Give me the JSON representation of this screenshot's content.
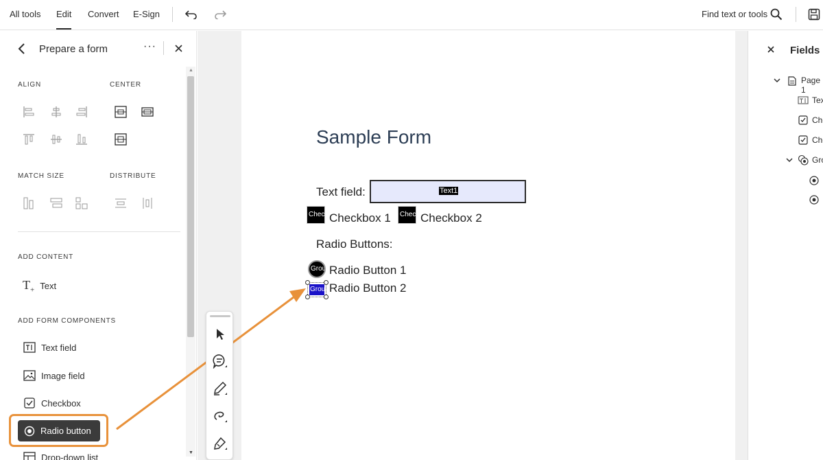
{
  "topbar": {
    "menu": [
      "All tools",
      "Edit",
      "Convert",
      "E-Sign"
    ],
    "search_label": "Find text or tools"
  },
  "left_panel": {
    "title": "Prepare a form",
    "align_label": "ALIGN",
    "center_label": "CENTER",
    "match_size_label": "MATCH SIZE",
    "distribute_label": "DISTRIBUTE",
    "add_content_label": "ADD CONTENT",
    "add_text": "Text",
    "add_form_label": "ADD FORM COMPONENTS",
    "components": [
      "Text field",
      "Image field",
      "Checkbox",
      "Radio button",
      "Drop-down list"
    ]
  },
  "document": {
    "title": "Sample Form",
    "text_field_label": "Text field:",
    "text_field_tag": "Text1",
    "checkbox1_tag": "Chec",
    "checkbox1_label": "Checkbox 1",
    "checkbox2_tag": "Chec",
    "checkbox2_label": "Checkbox 2",
    "radio_heading": "Radio Buttons:",
    "radio1_tag": "Grou",
    "radio1_label": "Radio Button 1",
    "radio2_tag": "Grou",
    "radio2_label": "Radio Button 2"
  },
  "fields_panel": {
    "title": "Fields",
    "items": [
      "Page 1",
      "Tex",
      "Che",
      "Che",
      "Gro"
    ]
  },
  "colors": {
    "accent_orange": "#e8913a",
    "text_field_fill": "#e6e9fc",
    "radio_selected": "#1a12c8"
  }
}
